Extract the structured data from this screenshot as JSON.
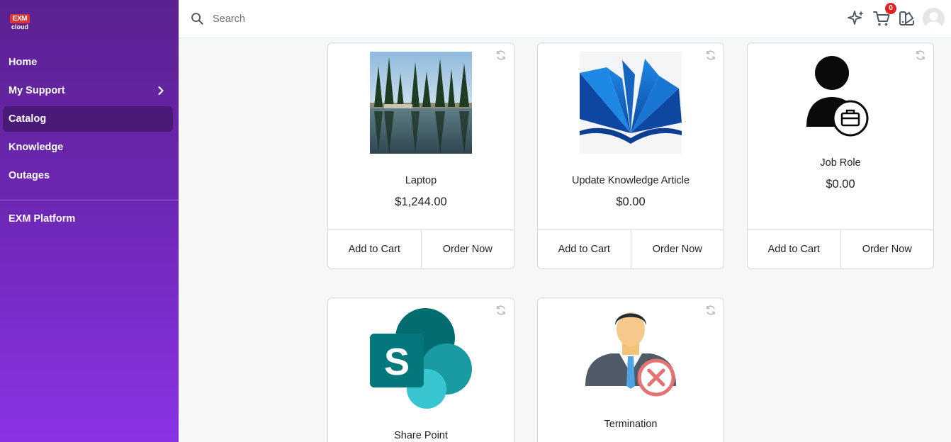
{
  "brand": {
    "logo_top": "EXM",
    "logo_bottom": "cloud"
  },
  "sidebar": {
    "items": [
      {
        "label": "Home"
      },
      {
        "label": "My Support"
      },
      {
        "label": "Catalog"
      },
      {
        "label": "Knowledge"
      },
      {
        "label": "Outages"
      }
    ],
    "platform_label": "EXM Platform"
  },
  "header": {
    "search_placeholder": "Search",
    "cart_count": "0",
    "icons": [
      "sparkle-icon",
      "cart-icon",
      "palette-icon",
      "user-avatar"
    ]
  },
  "catalog": {
    "cards": [
      {
        "title": "Laptop",
        "price": "$1,244.00",
        "add_to_cart": "Add to Cart",
        "order_now": "Order Now"
      },
      {
        "title": "Update Knowledge Article",
        "price": "$0.00",
        "add_to_cart": "Add to Cart",
        "order_now": "Order Now"
      },
      {
        "title": "Job Role",
        "price": "$0.00",
        "add_to_cart": "Add to Cart",
        "order_now": "Order Now"
      },
      {
        "title": "Share Point"
      },
      {
        "title": "Termination"
      }
    ]
  },
  "colors": {
    "sidebar_top": "#5b2190",
    "sidebar_bottom": "#8a33e6",
    "active_nav": "#4a1a78",
    "badge": "#e02424"
  }
}
